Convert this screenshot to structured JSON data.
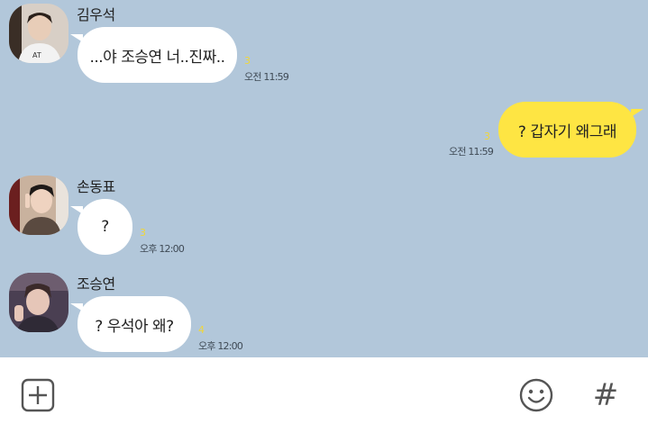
{
  "messages": [
    {
      "sender": "김우석",
      "text": "...야 조승연 너..진짜..",
      "unread": "3",
      "time": "오전 11:59",
      "direction": "in"
    },
    {
      "text": "? 갑자기 왜그래",
      "unread": "3",
      "time": "오전 11:59",
      "direction": "out"
    },
    {
      "sender": "손동표",
      "text": "?",
      "unread": "3",
      "time": "오후 12:00",
      "direction": "in"
    },
    {
      "sender": "조승연",
      "text": "? 우석아 왜?",
      "unread": "4",
      "time": "오후 12:00",
      "direction": "in"
    }
  ],
  "input_bar": {
    "icons": [
      "plus-square-icon",
      "emoji-icon",
      "hashtag-icon"
    ],
    "hashtag_glyph": "#"
  },
  "colors": {
    "chat_background": "#b2c7da",
    "outgoing_bubble": "#fee543",
    "incoming_bubble": "#ffffff",
    "unread_count": "#f0d63a"
  }
}
